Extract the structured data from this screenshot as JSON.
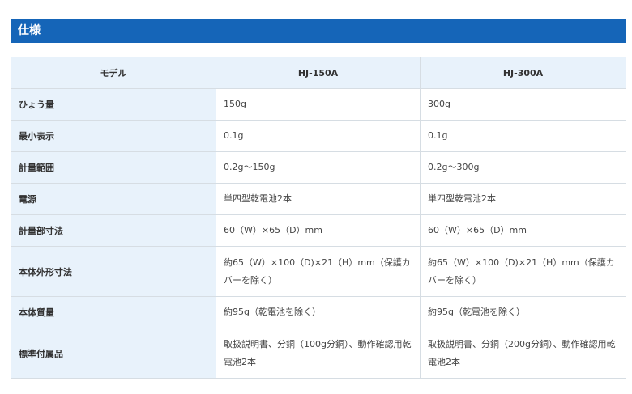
{
  "section": {
    "title": "仕様"
  },
  "table": {
    "headers": [
      "モデル",
      "HJ-150A",
      "HJ-300A"
    ],
    "rows": [
      {
        "label": "ひょう量",
        "hj150a": "150g",
        "hj300a": "300g"
      },
      {
        "label": "最小表示",
        "hj150a": "0.1g",
        "hj300a": "0.1g"
      },
      {
        "label": "計量範囲",
        "hj150a": "0.2g～150g",
        "hj300a": "0.2g～300g"
      },
      {
        "label": "電源",
        "hj150a": "単四型乾電池2本",
        "hj300a": "単四型乾電池2本"
      },
      {
        "label": "計量部寸法",
        "hj150a": "60（W）×65（D）mm",
        "hj300a": "60（W）×65（D）mm"
      },
      {
        "label": "本体外形寸法",
        "hj150a": "約65（W）×100（D)×21（H）mm（保護カバーを除く）",
        "hj300a": "約65（W）×100（D)×21（H）mm（保護カバーを除く）"
      },
      {
        "label": "本体質量",
        "hj150a": "約95g（乾電池を除く）",
        "hj300a": "約95g（乾電池を除く）"
      },
      {
        "label": "標準付属品",
        "hj150a": "取扱説明書、分銅（100g分銅）、動作確認用乾電池2本",
        "hj300a": "取扱説明書、分銅（200g分銅）、動作確認用乾電池2本"
      }
    ]
  }
}
